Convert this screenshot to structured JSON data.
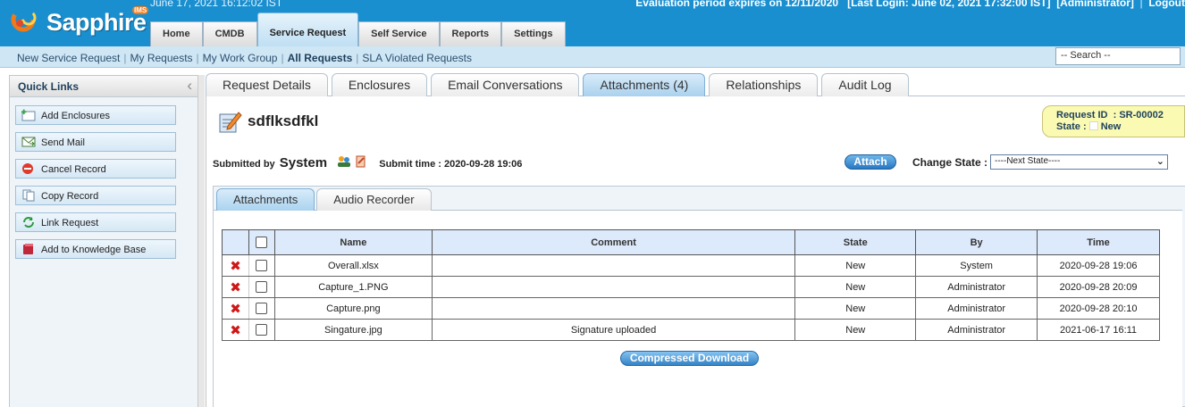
{
  "header": {
    "brand": "Sapphire",
    "brand_badge": "IMS",
    "datetime": "June 17, 2021 16:12:02 IST",
    "evaluation": "Evaluation period expires on 12/11/2020",
    "last_login": "[Last Login: June 02, 2021 17:32:00 IST]",
    "user": "[Administrator]",
    "logout": "Logout"
  },
  "main_tabs": [
    "Home",
    "CMDB",
    "Service Request",
    "Self Service",
    "Reports",
    "Settings"
  ],
  "sub_nav": {
    "items": [
      "New Service Request",
      "My Requests",
      "My Work Group",
      "All Requests",
      "SLA Violated Requests"
    ],
    "active": "All Requests",
    "search_placeholder": "-- Search --"
  },
  "quick_links": {
    "title": "Quick Links",
    "items": [
      "Add Enclosures",
      "Send Mail",
      "Cancel Record",
      "Copy Record",
      "Link Request",
      "Add to Knowledge Base"
    ]
  },
  "record_tabs": [
    "Request Details",
    "Enclosures",
    "Email Conversations",
    "Attachments (4)",
    "Relationships",
    "Audit Log"
  ],
  "record": {
    "title": "sdflksdfkl",
    "request_id_label": "Request ID",
    "request_id": ": SR-00002",
    "state_label": "State :",
    "state": "New",
    "submitted_by_label": "Submitted by",
    "submitted_by": "System",
    "submit_time": "Submit time : 2020-09-28 19:06",
    "attach_button": "Attach",
    "change_state_label": "Change State :",
    "next_state": "----Next State----"
  },
  "inner_tabs": [
    "Attachments",
    "Audio Recorder"
  ],
  "attachments": {
    "columns": [
      "Name",
      "Comment",
      "State",
      "By",
      "Time"
    ],
    "rows": [
      {
        "name": "Overall.xlsx",
        "comment": "",
        "state": "New",
        "by": "System",
        "time": "2020-09-28 19:06"
      },
      {
        "name": "Capture_1.PNG",
        "comment": "",
        "state": "New",
        "by": "Administrator",
        "time": "2020-09-28 20:09"
      },
      {
        "name": "Capture.png",
        "comment": "",
        "state": "New",
        "by": "Administrator",
        "time": "2020-09-28 20:10"
      },
      {
        "name": "Singature.jpg",
        "comment": "Signature uploaded",
        "state": "New",
        "by": "Administrator",
        "time": "2021-06-17 16:11"
      }
    ],
    "download_button": "Compressed Download"
  },
  "colors": {
    "header_blue": "#1a8fd0",
    "subnav_bg": "#cfe6f5",
    "active_tab": "#a9d1ee",
    "badge_yellow": "#fafab2",
    "delete_red": "#d01717"
  },
  "icons": {
    "logo": "sapphire-swirl-logo",
    "collapse": "chevron-left-icon",
    "record": "edit-record-icon",
    "delete": "delete-x-icon"
  }
}
